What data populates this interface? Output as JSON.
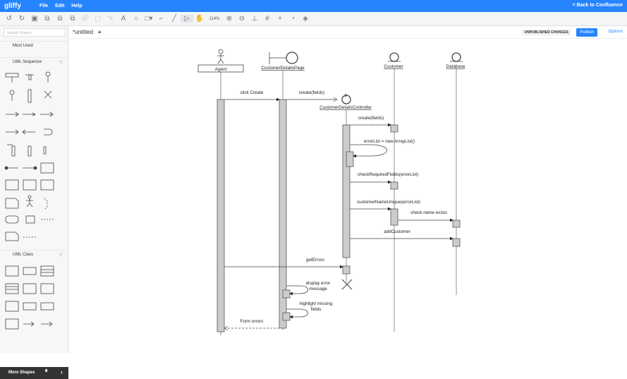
{
  "app": {
    "logo": "gliffy",
    "menu": [
      "File",
      "Edit",
      "Help"
    ],
    "back": "< Back to Confluence"
  },
  "toolbar": {
    "zoom": "114%"
  },
  "doc": {
    "title": "*untitled",
    "unpublished": "UNPUBLISHED CHANGES",
    "publish": "Publish",
    "options": "Options"
  },
  "sidebar": {
    "search_placeholder": "Search Shapes",
    "sections": [
      "Most Used",
      "UML Sequence",
      "UML Class"
    ],
    "more": "More Shapes"
  },
  "diagram": {
    "participants": [
      "Agent",
      "CustomerDetailsPage",
      "CustomerDetailsController",
      "Customer",
      "Database"
    ],
    "messages": {
      "m1": "click Create",
      "m2": "create(fields)",
      "m3": "create(fields)",
      "m4": "errorList = new ArrayList()",
      "m5": "checkRequiredFields(errorList)",
      "m6": "customerNameUnique(errorList)",
      "m7": "check name exists",
      "m8": "addCustomer",
      "m9": "getErrors",
      "m10a": "display error",
      "m10b": "message",
      "m11a": "highlight missing",
      "m11b": "fields",
      "m12": "Form errors"
    }
  },
  "colors": {
    "brand": "#2684ff",
    "activation": "#cccccc"
  }
}
